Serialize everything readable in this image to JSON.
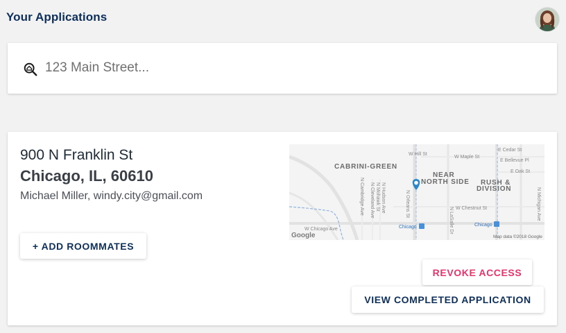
{
  "header": {
    "title": "Your Applications"
  },
  "search": {
    "placeholder": "123 Main Street..."
  },
  "application": {
    "street": "900 N Franklin St",
    "city_line": "Chicago, IL, 60610",
    "contact": "Michael Miller, windy.city@gmail.com",
    "add_roommates_label": "+ ADD ROOMMATES",
    "revoke_label": "REVOKE ACCESS",
    "view_label": "VIEW COMPLETED APPLICATION"
  },
  "map": {
    "labels": {
      "cabrini": "CABRINI-GREEN",
      "near": "NEAR",
      "north_side": "NORTH SIDE",
      "rush": "RUSH &",
      "division": "DIVISION",
      "w_hill": "W Hill St",
      "w_maple": "W Maple St",
      "e_cedar": "E Cedar St",
      "e_bellevue": "E Bellevue Pl",
      "e_oak": "E Oak St",
      "w_chestnut": "W Chestnut St",
      "w_chicago": "W Chicago Ave",
      "n_michigan": "N Michigan Ave",
      "n_cambridge": "N Cambridge Ave",
      "n_cleveland": "N Cleveland Ave",
      "n_mohawk": "N Mohawk St",
      "n_hudson": "N Hudson Ave",
      "n_orleans": "N Orleans St",
      "n_lasalle": "N LaSalle Dr",
      "chicago_station_1": "Chicago",
      "chicago_station_2": "Chicago",
      "google": "Google",
      "attribution": "Map data ©2018 Google"
    },
    "colors": {
      "water": "#8fb4e0",
      "pin": "#2c86c7",
      "transit": "#4a90d9",
      "road": "#ffffff"
    }
  }
}
